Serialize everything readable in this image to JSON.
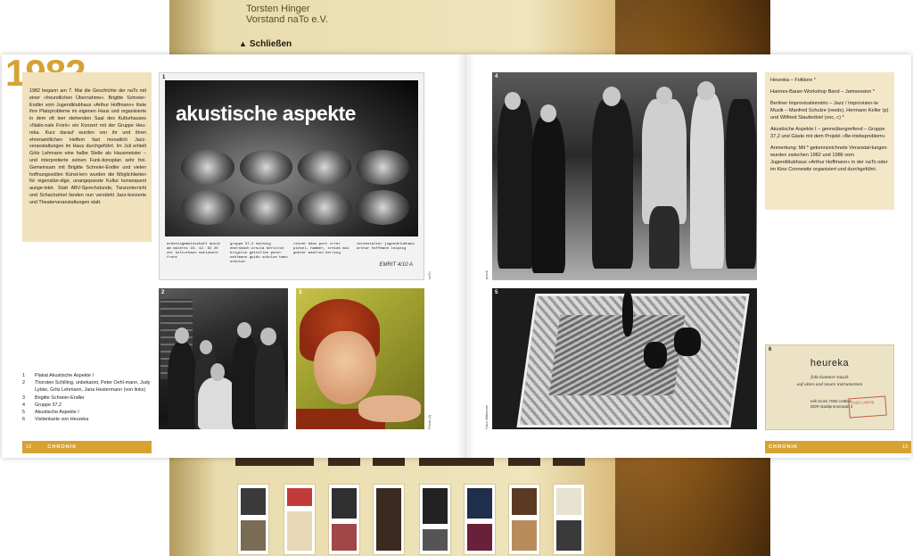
{
  "background": {
    "header_name": "Torsten Hinger",
    "header_role": "Vorstand naTo e.V.",
    "close_label": "Schließen",
    "close_icon": "triangle-up-icon"
  },
  "spread": {
    "year": "1982",
    "intro_text": "1982 begann am 7. Mai die Geschichte der naTo mit einer »freundlichen Übernahme«. Brigitte Schreier-Endler vom Jugendklubhaus »Arthur Hoffmann« löste ihre Platzprobleme im eigenen Haus und organisierte in dem oft leer stehenden Saal des Kulturhauses »Natio-nale Front« ein Konzert mit der Gruppe Heu-reka. Kurz darauf wurden von ihr und ihren ehrenamtlichen Helfern fast monatlich Jazz-veranstaltungen im Haus durchgeführt. Im Juli erhielt Götz Lehmann eine halbe Stelle als Hausmeister – und interpretierte seinen Funk-tionsplan sehr frei. Gemeinsam mit Brigitte Schreier-Endler und vielen hoffnungsvollen Künst-lern wurden die Möglichkeiten für eigenstän-dige, unangepasste Kultur konsequent ausge-lotet. Statt ABV-Sprechstunde, Tanzunterricht und Schachzirkel fanden nun verstärkt Jazz-konzerte und Theaterveranstaltungen statt.",
    "sidebar": [
      "Heureka – Folklore *",
      "Hannes-Bauer-Workshop Band – Jamsession *",
      "Berliner Improvisationstrio – Jazz / Improvisier-te Musik – Manfred Schulze (reeds), Hermann Keller (p) und Wilfried Staufenbiel (voc, c) *",
      "Akustische Aspekte I – genreübergreifend – Gruppe 37,2 und Gäste mit dem Projekt »Be-triebsproblem«",
      "Anmerkung: Mit * gekennzeichnete Veranstal-tungen wurden zwischen 1982 und 1986 vom Jugendklubhaus »Arthur Hoffmann« in der naTo oder im Kino Connewitz organisiert und durchgeführt."
    ],
    "captions": [
      {
        "num": "1",
        "text": "Plakat Akustische Aspekte I"
      },
      {
        "num": "2",
        "text": "Thorsten Schilling, unbekannt, Peter Oehl-mann, Judy Lybke, Götz Lehmann, Jana Hestermann (von links)"
      },
      {
        "num": "3",
        "text": "Brigitte Schreier-Endler"
      },
      {
        "num": "4",
        "text": "Gruppe 37,2"
      },
      {
        "num": "5",
        "text": "Akustische Aspekte I"
      },
      {
        "num": "6",
        "text": "Visitenkarte von Heureka"
      }
    ],
    "footer_left": {
      "page": "12",
      "label": "CHRONIK"
    },
    "footer_right": {
      "label": "CHRONIK",
      "page": "13"
    },
    "photos": {
      "p1": {
        "num": "1",
        "poster_title": "akustische aspekte",
        "info_col1": "arbeitsgemeinschaft musik am malerei 16. 12. 82 20 uhr kulturhaus nationale front",
        "info_col2": "gruppe 37,2 hartwig ebersbach ursula bertolsh brigitte gettellen peter oehlmann guido schulze hans schulze",
        "info_col3": "reiner bänz pert irrer pinsel, hammer, sreide mio günter manfred herling",
        "info_col4": "veranstalter jugendklubhaus arthur hoffmann leipzig",
        "signature": "EMRIT 4/10 A"
      },
      "p2": {
        "num": "2"
      },
      "p3": {
        "num": "3"
      },
      "p4": {
        "num": "4"
      },
      "p5": {
        "num": "5"
      },
      "p6": {
        "num": "6",
        "card_title": "heureka",
        "card_sub_line1": "folk-kammer-musik",
        "card_sub_line2": "auf alten und neuen instrumenten",
        "card_address": "erik kross 7050 cottbus DDR stadtpromenade 3",
        "card_stamp": "7050 Leipzig"
      }
    },
    "credits": {
      "p1": "naTo",
      "p3": "Privat (3)",
      "p4": "privat",
      "p5": "Hans Bittkamm"
    }
  }
}
